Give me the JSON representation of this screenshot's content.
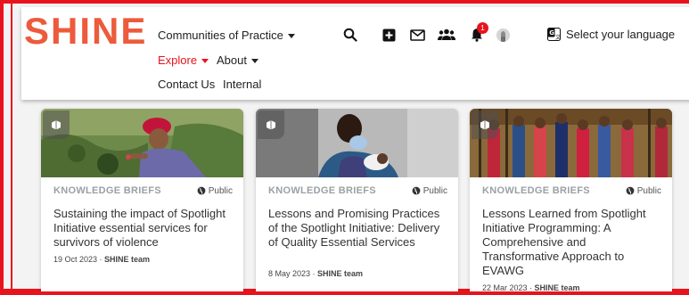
{
  "header": {
    "logo": "SHINE",
    "nav": {
      "communities": "Communities of Practice",
      "explore": "Explore",
      "about": "About",
      "contact": "Contact Us",
      "internal": "Internal"
    },
    "notification_count": "1",
    "language_label": "Select your language"
  },
  "cards": [
    {
      "type": "KNOWLEDGE BRIEFS",
      "visibility": "Public",
      "title": "Sustaining the impact of Spotlight Initiative essential services for survivors of violence",
      "date": "19 Oct 2023",
      "author": "SHINE team"
    },
    {
      "type": "KNOWLEDGE BRIEFS",
      "visibility": "Public",
      "title": "Lessons and Promising Practices of the Spotlight Initiative: Delivery of Quality Essential Services",
      "date": "8 May 2023",
      "author": "SHINE team"
    },
    {
      "type": "KNOWLEDGE BRIEFS",
      "visibility": "Public",
      "title": "Lessons Learned from Spotlight Initiative Programming: A Comprehensive and Transformative Approach to EVAWG",
      "date": "22 Mar 2023",
      "author": "SHINE team"
    }
  ],
  "colors": {
    "brand_red": "#e8141d",
    "logo_orange": "#ec5b3c"
  },
  "icons": {
    "search": "search-icon",
    "add": "add-box-icon",
    "mail": "mail-icon",
    "people": "people-icon",
    "bell": "bell-icon",
    "translate": "translate-icon",
    "globe": "globe-icon",
    "brief": "knowledge-brief-icon"
  }
}
